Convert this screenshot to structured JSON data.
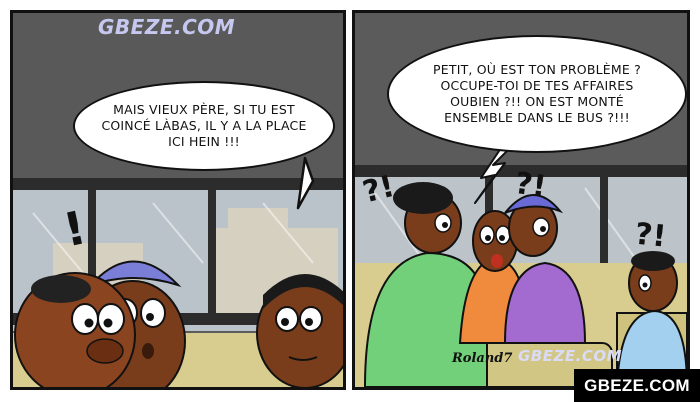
{
  "watermark": "GBEZE.COM",
  "signature": "Roland7",
  "panel_left": {
    "speech": "MAIS VIEUX PÈRE, SI TU EST COINCÉ LÀBAS, IL Y A LA PLACE ICI HEIN !!!",
    "exclamation": "!"
  },
  "panel_right": {
    "speech": "PETIT, OÙ EST TON PROBLÈME ? OCCUPE-TOI DE TES AFFAIRES OUBIEN ?!! ON EST MONTÉ ENSEMBLE DANS LE BUS ?!!!",
    "marks": [
      "?!",
      "?!",
      "?!"
    ]
  },
  "footer": {
    "site_badge": "GBEZE.COM"
  },
  "colors": {
    "skin": "#7a3d1c",
    "hat": "#7b7ed6",
    "dress": "#72d07a",
    "bus_seat": "#d8cd8e"
  }
}
